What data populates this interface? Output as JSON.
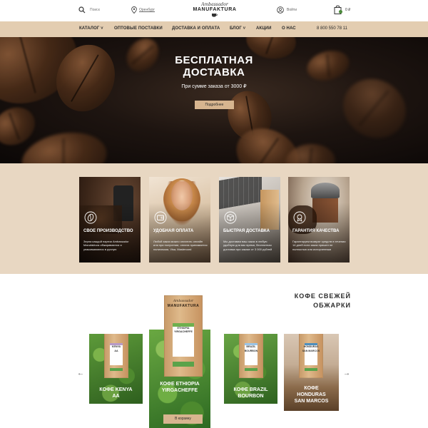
{
  "topbar": {
    "search_label": "Поиск",
    "city": "Оренбург",
    "logo_script": "Ambassador",
    "logo_brand": "MANUFAKTURA",
    "login": "Войти",
    "cart_total": "0 ₽"
  },
  "nav": {
    "items": [
      {
        "label": "КАТАЛОГ ˅"
      },
      {
        "label": "ОПТОВЫЕ ПОСТАВКИ"
      },
      {
        "label": "ДОСТАВКА И ОПЛАТА"
      },
      {
        "label": "БЛОГ ˅"
      },
      {
        "label": "АКЦИИ"
      },
      {
        "label": "О НАС"
      }
    ],
    "phone": "8 800 550 78 11"
  },
  "hero": {
    "title_line1": "БЕСПЛАТНАЯ",
    "title_line2": "ДОСТАВКА",
    "subtitle": "При сумме заказа от 3000 ₽",
    "button": "Подробнее"
  },
  "features": [
    {
      "title": "СВОЕ ПРОИЗВОДСТВО",
      "text": "Зерна каждой партии Ambassador Manufaktura обжариваются и упаковываются в ручную",
      "icon": "coffee-bean-icon"
    },
    {
      "title": "УДОБНАЯ ОПЛАТА",
      "text": "Любой заказ можно оплатить онлайн или при получении, оплата принимается наличными, Visa, Mastercard",
      "icon": "wallet-icon"
    },
    {
      "title": "БЫСТРАЯ ДОСТАВКА",
      "text": "Мы доставим ваш заказ в любую удобную для вас время, бесплатная доставка при заказе от 3 000 рублей",
      "icon": "box-icon"
    },
    {
      "title": "ГАРАНТИЯ КАЧЕСТВА",
      "text": "Гарантируем возврат средств в течении 14 дней если заказ пришел не полностью или испорченным",
      "icon": "quality-badge-icon"
    }
  ],
  "products": {
    "section_title_line1": "КОФЕ СВЕЖЕЙ",
    "section_title_line2": "ОБЖАРКИ",
    "prev_arrow": "←",
    "next_arrow": "→",
    "items": [
      {
        "title_line1": "КОФЕ KENYA",
        "title_line2": "AA",
        "bag_line1": "KENYA",
        "bag_line2": "AA",
        "accent": "#b79ac8"
      },
      {
        "title_line1": "КОФЕ ETHIOPIA",
        "title_line2": "YIRGACHEFFE",
        "bag_line1": "ETHIOPIA",
        "bag_line2": "YIRGACHEFFE",
        "accent": "#6fb04e",
        "button": "В корзину"
      },
      {
        "title_line1": "КОФЕ BRAZIL",
        "title_line2": "BOURBON",
        "bag_line1": "BRAZIL",
        "bag_line2": "BOURBON",
        "accent": "#9ac4e6"
      },
      {
        "title_line1": "КОФЕ",
        "title_line2": "HONDURAS",
        "title_line3": "SAN MARCOS",
        "bag_line1": "HONDURAS",
        "bag_line2": "SAN MARCOS",
        "accent": "#4e8fbe"
      }
    ],
    "featured_brand_script": "Ambassador",
    "featured_brand": "MANUFAKTURA"
  },
  "colors": {
    "nav_bg": "#e3cdb1",
    "features_bg": "#e8d7c2",
    "button_bg": "#d7b58f",
    "hero_dark": "#120c09"
  }
}
